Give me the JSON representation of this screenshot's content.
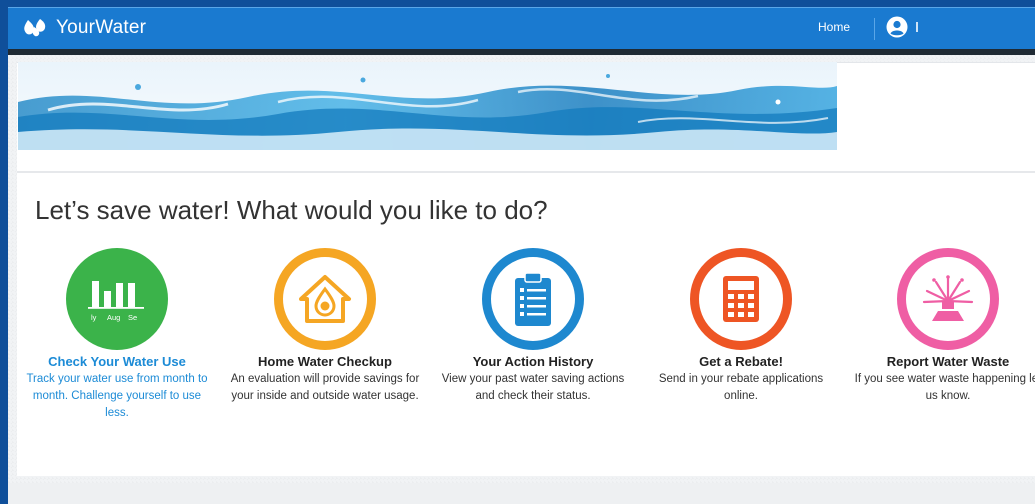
{
  "app": {
    "name": "YourWater"
  },
  "nav": {
    "home": "Home"
  },
  "page": {
    "headline": "Let’s save water! What would you like to do?"
  },
  "chart_icon": {
    "labels": [
      "ly",
      "Aug",
      "Se"
    ]
  },
  "tiles": [
    {
      "title": "Check Your Water Use",
      "description": "Track your water use from month to month. Challenge yourself to use less.",
      "color": "#3bb34a",
      "icon": "bar-chart-icon"
    },
    {
      "title": "Home Water Checkup",
      "description": "An evaluation will provide savings for your inside and outside water usage.",
      "color": "#f5a623",
      "icon": "house-drop-icon"
    },
    {
      "title": "Your Action History",
      "description": "View your past water saving actions and check their status.",
      "color": "#1e88cf",
      "icon": "clipboard-list-icon"
    },
    {
      "title": "Get a Rebate!",
      "description": "Send in your rebate applications online.",
      "color": "#ee5524",
      "icon": "calculator-icon"
    },
    {
      "title": "Report Water Waste",
      "description": "If you see water waste happening let us know.",
      "color": "#ef5ea4",
      "icon": "sprinkler-icon"
    }
  ]
}
